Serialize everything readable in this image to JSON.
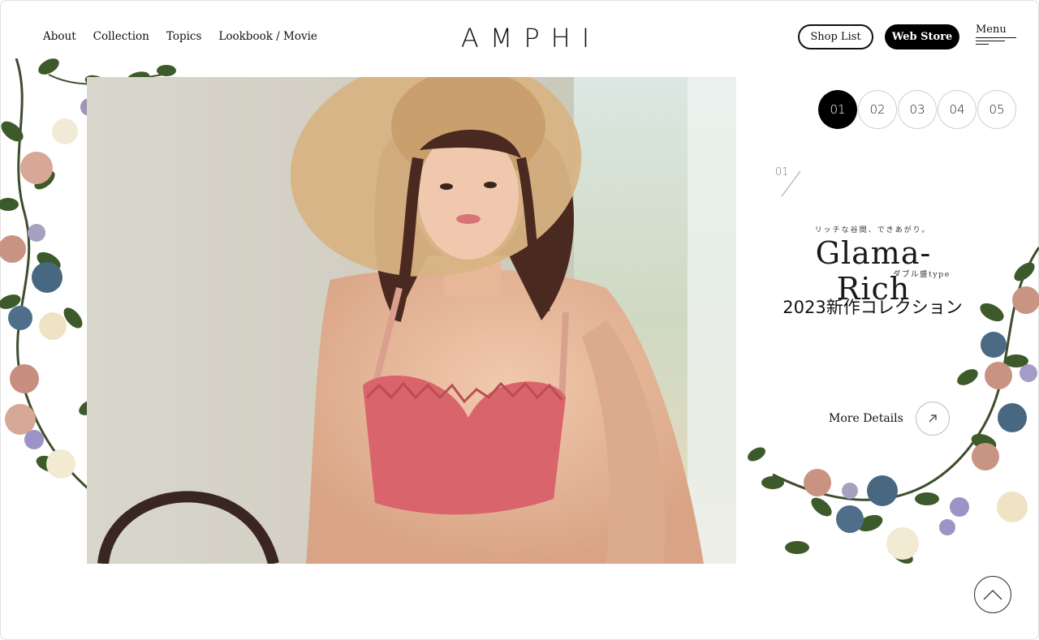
{
  "nav": {
    "items": [
      {
        "label": "About"
      },
      {
        "label": "Collection"
      },
      {
        "label": "Topics"
      },
      {
        "label": "Lookbook / Movie"
      }
    ]
  },
  "logo": {
    "text": "AMPHI"
  },
  "header": {
    "shop_list_label": "Shop List",
    "web_store_label": "Web Store",
    "menu_label": "Menu"
  },
  "pager": {
    "items": [
      "01",
      "02",
      "03",
      "04",
      "05"
    ],
    "active_index": 0
  },
  "slide": {
    "number": "01",
    "tagline": "リッチな谷間、できあがり。",
    "brand": "Glama-Rich",
    "subbrand": "ダブル盛type",
    "headline": "2023新作コレクション",
    "more_label": "More Details"
  },
  "icons": {
    "more": "arrow-up-right-icon",
    "back_to_top": "chevron-up-icon"
  },
  "colors": {
    "accent": "#000000",
    "background": "#ffffff",
    "bra": "#d9646b"
  }
}
